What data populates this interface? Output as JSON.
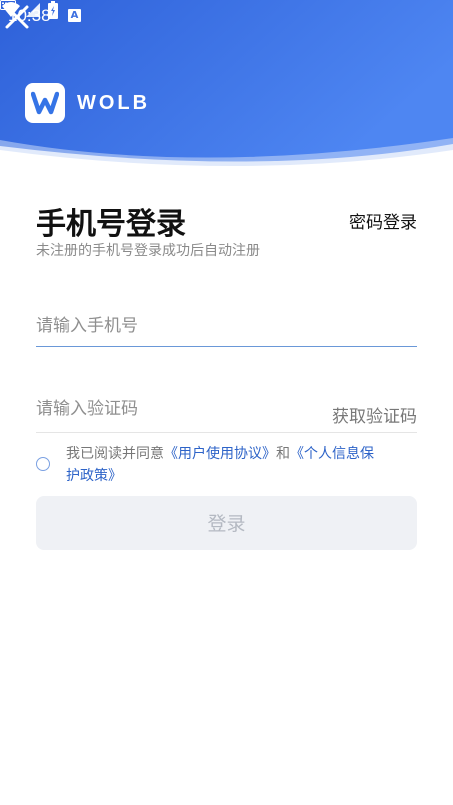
{
  "status_bar": {
    "time": "10:38",
    "a_badge": "A",
    "icons": [
      "font-notification-icon",
      "keyboard-icon",
      "wifi-icon",
      "signal-icon",
      "battery-icon"
    ]
  },
  "header": {
    "brand_name": "WOLB",
    "gradient_colors": [
      "#2e61d9",
      "#4e86f2"
    ]
  },
  "login": {
    "title": "手机号登录",
    "password_login": "密码登录",
    "subtitle": "未注册的手机号登录成功后自动注册",
    "phone_placeholder": "请输入手机号",
    "code_placeholder": "请输入验证码",
    "get_code": "获取验证码",
    "agreement": {
      "prefix": "我已阅读并同意",
      "user_agreement": "《用户使用协议》",
      "and": "和",
      "privacy_policy": "《个人信息保护政策》",
      "checked": false
    },
    "submit": "登录"
  },
  "colors": {
    "accent": "#2d63c8",
    "button_bg": "#eff1f5",
    "button_text": "#b4b9c2",
    "input_underline": "#6a98d8"
  }
}
